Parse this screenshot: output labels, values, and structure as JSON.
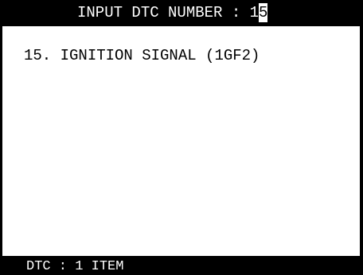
{
  "header": {
    "prompt_label": "INPUT DTC NUMBER : ",
    "dtc_value_first": "1",
    "dtc_value_cursor": "5"
  },
  "dtc_list": [
    {
      "entry": "15. IGNITION SIGNAL (1GF2)"
    }
  ],
  "footer": {
    "status_label": "DTC : ",
    "item_count": "1",
    "item_unit": " ITEM"
  },
  "colors": {
    "bar_background": "#000000",
    "bar_text": "#ffffff",
    "screen_background": "#ffffff",
    "screen_text": "#000000"
  }
}
